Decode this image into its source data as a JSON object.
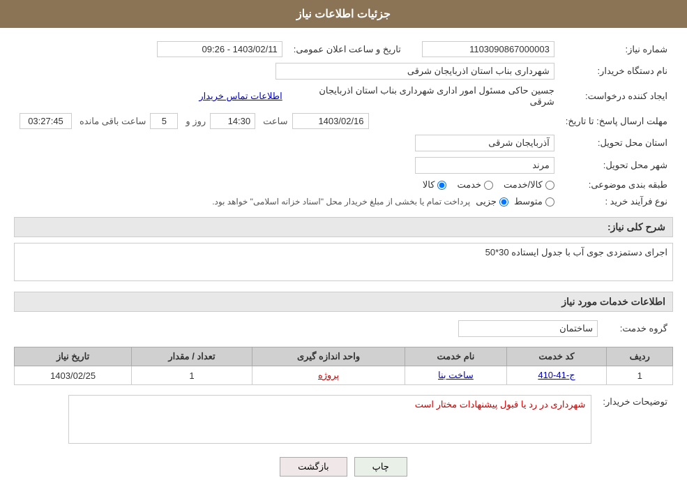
{
  "header": {
    "title": "جزئیات اطلاعات نیاز"
  },
  "fields": {
    "need_number_label": "شماره نیاز:",
    "need_number_value": "1103090867000003",
    "announce_date_label": "تاریخ و ساعت اعلان عمومی:",
    "announce_date_value": "1403/02/11 - 09:26",
    "buyer_org_label": "نام دستگاه خریدار:",
    "buyer_org_value": "شهرداری بناب استان اذربایجان شرقی",
    "creator_label": "ایجاد کننده درخواست:",
    "creator_value": "جسین  حاکی مسئول امور اداری شهرداری بناب استان اذربایجان شرقی",
    "contact_link": "اطلاعات تماس خریدار",
    "deadline_label": "مهلت ارسال پاسخ: تا تاریخ:",
    "deadline_date": "1403/02/16",
    "deadline_time_label": "ساعت",
    "deadline_time": "14:30",
    "deadline_days_label": "روز و",
    "deadline_days": "5",
    "deadline_remaining_label": "ساعت باقی مانده",
    "deadline_remaining": "03:27:45",
    "province_label": "استان محل تحویل:",
    "province_value": "آذربایجان شرقی",
    "city_label": "شهر محل تحویل:",
    "city_value": "مرند",
    "category_label": "طبقه بندی موضوعی:",
    "category_options": [
      "کالا",
      "خدمت",
      "کالا/خدمت"
    ],
    "category_selected": "کالا",
    "purchase_type_label": "نوع فرآیند خرید :",
    "purchase_type_options": [
      "جزیی",
      "متوسط"
    ],
    "purchase_type_description": "پرداخت تمام یا بخشی از مبلغ خریدار محل \"اسناد خزانه اسلامی\" خواهد بود.",
    "need_description_label": "شرح کلی نیاز:",
    "need_description_value": "اجرای دستمزدی جوی آب با جدول ایستاده 30*50",
    "services_section_label": "اطلاعات خدمات مورد نیاز",
    "service_group_label": "گروه خدمت:",
    "service_group_value": "ساختمان",
    "table": {
      "headers": [
        "ردیف",
        "کد خدمت",
        "نام خدمت",
        "واحد اندازه گیری",
        "تعداد / مقدار",
        "تاریخ نیاز"
      ],
      "rows": [
        {
          "row_num": "1",
          "service_code": "ج-41-410",
          "service_name": "ساخت بنا",
          "unit": "پروژه",
          "quantity": "1",
          "date": "1403/02/25"
        }
      ]
    },
    "buyer_notes_label": "توضیحات خریدار:",
    "buyer_notes_value": "شهرداری در رد یا قبول پیشنهادات مختار است"
  },
  "buttons": {
    "print": "چاپ",
    "back": "بازگشت"
  }
}
